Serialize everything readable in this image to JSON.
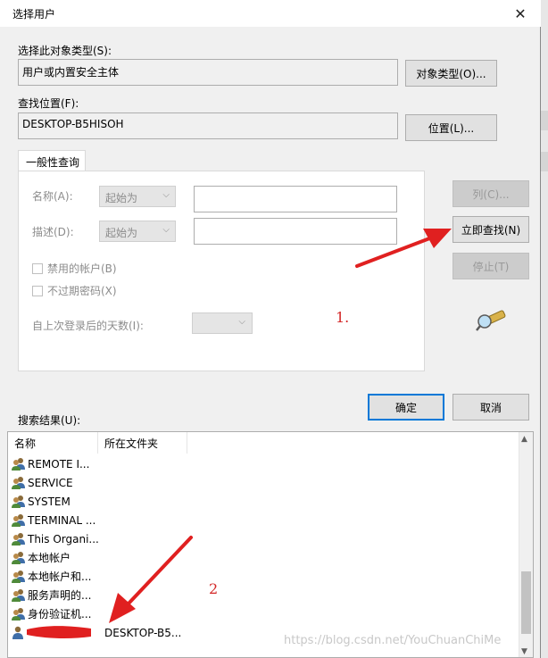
{
  "window": {
    "title": "选择用户",
    "close_glyph": "✕"
  },
  "object_type": {
    "label": "选择此对象类型(S):",
    "value": "用户或内置安全主体",
    "button": "对象类型(O)..."
  },
  "location": {
    "label": "查找位置(F):",
    "value": "DESKTOP-B5HISOH",
    "button": "位置(L)..."
  },
  "tab": {
    "label": "一般性查询"
  },
  "query": {
    "name_label": "名称(A):",
    "name_mode": "起始为",
    "desc_label": "描述(D):",
    "desc_mode": "起始为",
    "disabled_accounts": "禁用的帐户(B)",
    "non_expiring_pw": "不过期密码(X)",
    "days_label": "自上次登录后的天数(I):",
    "combo_arrow": "⌵"
  },
  "side_buttons": {
    "columns": "列(C)...",
    "find_now": "立即查找(N)",
    "stop": "停止(T)"
  },
  "dialog_buttons": {
    "ok": "确定",
    "cancel": "取消"
  },
  "results": {
    "label": "搜索结果(U):",
    "columns": [
      "名称",
      "所在文件夹"
    ],
    "rows": [
      {
        "name": "REMOTE I...",
        "folder": ""
      },
      {
        "name": "SERVICE",
        "folder": ""
      },
      {
        "name": "SYSTEM",
        "folder": ""
      },
      {
        "name": "TERMINAL ...",
        "folder": ""
      },
      {
        "name": "This Organi...",
        "folder": ""
      },
      {
        "name": "本地帐户",
        "folder": ""
      },
      {
        "name": "本地帐户和...",
        "folder": ""
      },
      {
        "name": "服务声明的...",
        "folder": ""
      },
      {
        "name": "身份验证机...",
        "folder": ""
      },
      {
        "name": "",
        "folder": "DESKTOP-B5..."
      }
    ],
    "scroll_up": "▲",
    "scroll_down": "▼"
  },
  "annotations": {
    "step1": "1.",
    "step2": "2"
  },
  "watermark": "https://blog.csdn.net/YouChuanChiMe",
  "colors": {
    "accent": "#0078d7",
    "annotation": "#e02020"
  },
  "icons": {
    "search_tool": "binoculars-icon",
    "user_group": "user-group-icon"
  }
}
